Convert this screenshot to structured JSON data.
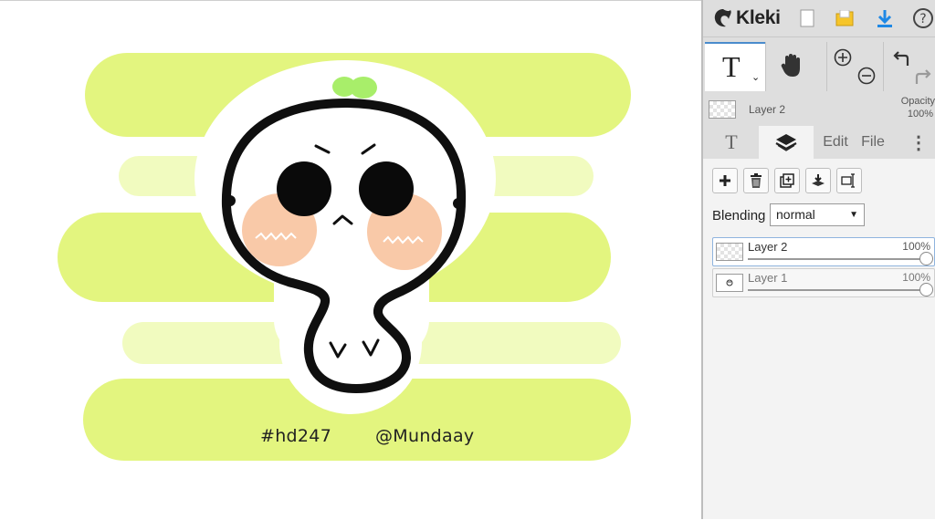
{
  "canvas": {
    "caption_left": "#hd247",
    "caption_right": "@Mundaay",
    "colors": {
      "stripe": "#e3f57f",
      "stripe_light": "#f1fbbf",
      "blush": "#f9c9a8",
      "sprout": "#a8ee6a"
    }
  },
  "app": {
    "name": "Kleki"
  },
  "toolbar": {
    "icons": [
      "new-file-icon",
      "open-folder-icon",
      "download-icon",
      "help-icon"
    ],
    "active_tool": "T",
    "tools": [
      "text-tool",
      "hand-tool",
      "zoom-in-icon",
      "zoom-out-icon",
      "undo-icon",
      "redo-icon"
    ]
  },
  "current_layer": {
    "name": "Layer 2",
    "opacity_label": "Opacity",
    "opacity_value": "100%"
  },
  "tabs": {
    "text_icon": "T",
    "edit": "Edit",
    "file": "File"
  },
  "layers_panel": {
    "blending_label": "Blending",
    "blending_value": "normal",
    "layers": [
      {
        "name": "Layer 2",
        "opacity": "100%"
      },
      {
        "name": "Layer 1",
        "opacity": "100%"
      }
    ]
  }
}
